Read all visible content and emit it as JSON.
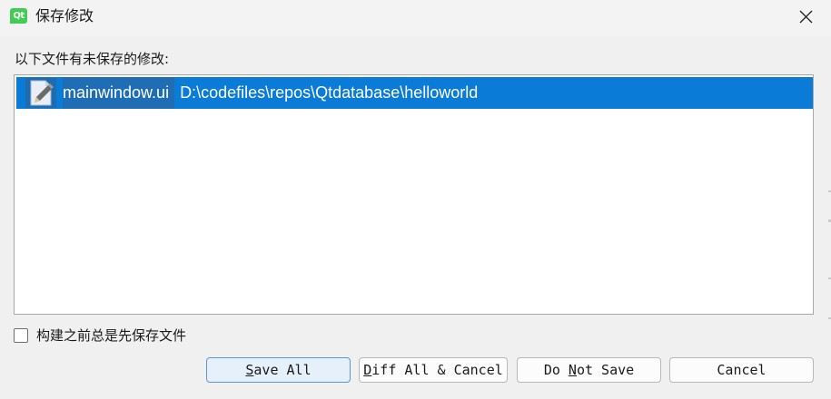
{
  "window": {
    "title": "保存修改",
    "app_icon_text": "Qt",
    "close_glyph": "✕"
  },
  "prompt": "以下文件有未保存的修改:",
  "files": [
    {
      "icon": "pencil-file-icon",
      "name": "mainwindow.ui",
      "path": "D:\\codefiles\\repos\\Qtdatabase\\helloworld",
      "selected": true
    }
  ],
  "options": {
    "save_before_build_label": "构建之前总是先保存文件",
    "save_before_build_checked": false
  },
  "buttons": {
    "save_all": {
      "pre": "",
      "mnemonic": "S",
      "post": "ave All"
    },
    "diff_cancel": {
      "pre": "",
      "mnemonic": "D",
      "post": "iff All & Cancel"
    },
    "do_not_save": {
      "pre": "Do ",
      "mnemonic": "N",
      "post": "ot Save"
    },
    "cancel": {
      "label": "Cancel"
    }
  },
  "colors": {
    "selection": "#0a7bd6",
    "qt_green": "#41cd52",
    "default_button_border": "#5b95d6"
  }
}
